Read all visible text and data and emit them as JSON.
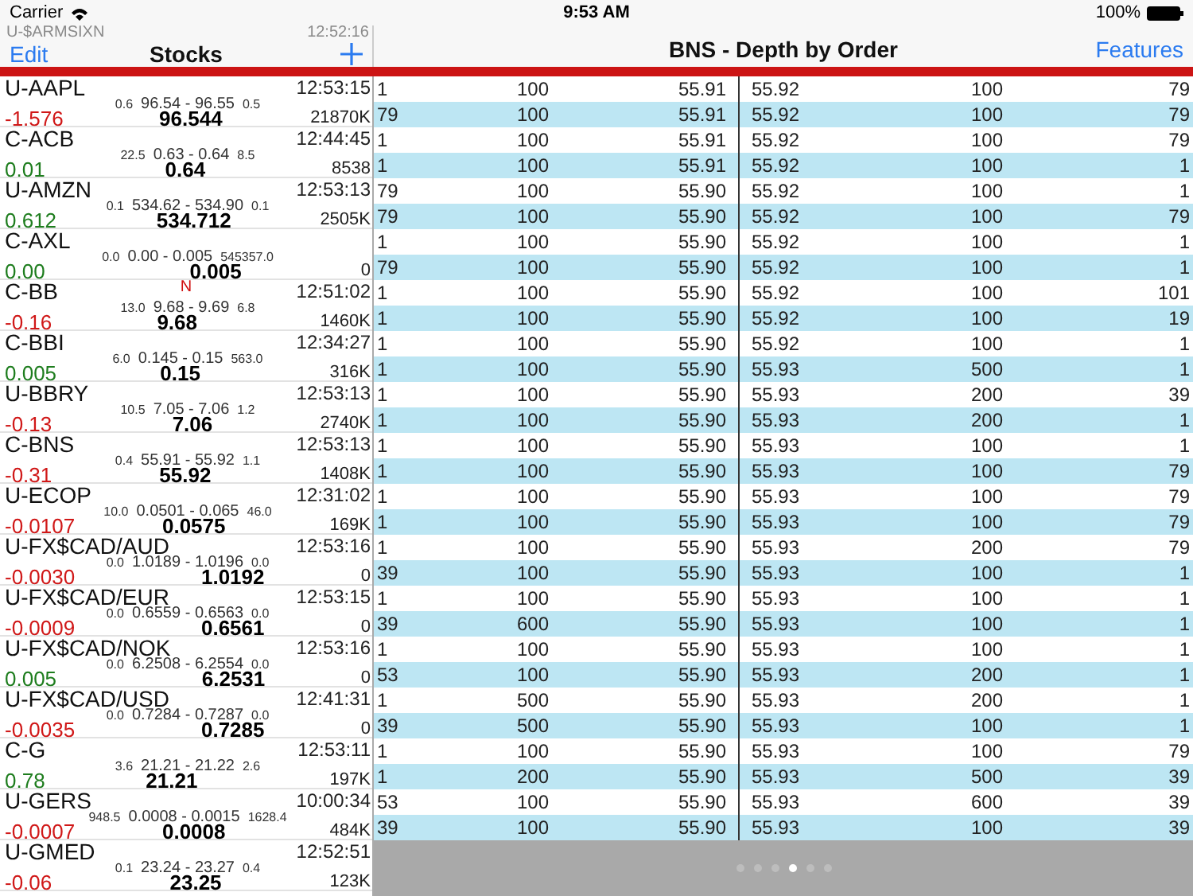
{
  "status_bar": {
    "carrier": "Carrier",
    "time": "9:53 AM",
    "battery": "100%"
  },
  "stocks_panel": {
    "edit_button": "Edit",
    "title": "Stocks",
    "ghost_row": {
      "symbol": "U-$ARMSIXN",
      "time": "12:52:16"
    },
    "stocks": [
      {
        "symbol": "U-AAPL",
        "time": "12:53:15",
        "bid_size": "0.6",
        "range": "96.54 - 96.55",
        "ask_size": "0.5",
        "change": "-1.576",
        "color": "#d01818",
        "last": "96.544",
        "volume": "21870K"
      },
      {
        "symbol": "C-ACB",
        "time": "12:44:45",
        "bid_size": "22.5",
        "range": "0.63 - 0.64",
        "ask_size": "8.5",
        "change": "0.01",
        "color": "#1e7d1e",
        "last": "0.64",
        "volume": "8538"
      },
      {
        "symbol": "U-AMZN",
        "time": "12:53:13",
        "bid_size": "0.1",
        "range": "534.62 - 534.90",
        "ask_size": "0.1",
        "change": "0.612",
        "color": "#1e7d1e",
        "last": "534.712",
        "volume": "2505K"
      },
      {
        "symbol": "C-AXL",
        "bid_size": "0.0",
        "range": "0.00 - 0.005",
        "ask_size": "545357.0",
        "change": "0.00",
        "color": "#1e7d1e",
        "last": "0.005",
        "volume": "0"
      },
      {
        "symbol": "C-BB",
        "time": "12:51:02",
        "flag": "N",
        "bid_size": "13.0",
        "range": "9.68 - 9.69",
        "ask_size": "6.8",
        "change": "-0.16",
        "color": "#d01818",
        "last": "9.68",
        "volume": "1460K"
      },
      {
        "symbol": "C-BBI",
        "time": "12:34:27",
        "bid_size": "6.0",
        "range": "0.145 - 0.15",
        "ask_size": "563.0",
        "change": "0.005",
        "color": "#1e7d1e",
        "last": "0.15",
        "volume": "316K"
      },
      {
        "symbol": "U-BBRY",
        "time": "12:53:13",
        "bid_size": "10.5",
        "range": "7.05 - 7.06",
        "ask_size": "1.2",
        "change": "-0.13",
        "color": "#d01818",
        "last": "7.06",
        "volume": "2740K"
      },
      {
        "symbol": "C-BNS",
        "time": "12:53:13",
        "bid_size": "0.4",
        "range": "55.91 - 55.92",
        "ask_size": "1.1",
        "change": "-0.31",
        "color": "#d01818",
        "last": "55.92",
        "volume": "1408K"
      },
      {
        "symbol": "U-ECOP",
        "time": "12:31:02",
        "bid_size": "10.0",
        "range": "0.0501 - 0.065",
        "ask_size": "46.0",
        "change": "-0.0107",
        "color": "#d01818",
        "last": "0.0575",
        "volume": "169K"
      },
      {
        "symbol": "U-FX$CAD/AUD",
        "time": "12:53:16",
        "bid_size": "0.0",
        "range": "1.0189 - 1.0196",
        "ask_size": "0.0",
        "change": "-0.0030",
        "color": "#d01818",
        "last": "1.0192",
        "volume": "0"
      },
      {
        "symbol": "U-FX$CAD/EUR",
        "time": "12:53:15",
        "bid_size": "0.0",
        "range": "0.6559 - 0.6563",
        "ask_size": "0.0",
        "change": "-0.0009",
        "color": "#d01818",
        "last": "0.6561",
        "volume": "0"
      },
      {
        "symbol": "U-FX$CAD/NOK",
        "time": "12:53:16",
        "bid_size": "0.0",
        "range": "6.2508 - 6.2554",
        "ask_size": "0.0",
        "change": "0.005",
        "color": "#1e7d1e",
        "last": "6.2531",
        "volume": "0"
      },
      {
        "symbol": "U-FX$CAD/USD",
        "time": "12:41:31",
        "bid_size": "0.0",
        "range": "0.7284 - 0.7287",
        "ask_size": "0.0",
        "change": "-0.0035",
        "color": "#d01818",
        "last": "0.7285",
        "volume": "0"
      },
      {
        "symbol": "C-G",
        "time": "12:53:11",
        "bid_size": "3.6",
        "range": "21.21 - 21.22",
        "ask_size": "2.6",
        "change": "0.78",
        "color": "#1e7d1e",
        "last": "21.21",
        "volume": "197K"
      },
      {
        "symbol": "U-GERS",
        "time": "10:00:34",
        "bid_size": "948.5",
        "range": "0.0008 - 0.0015",
        "ask_size": "1628.4",
        "change": "-0.0007",
        "color": "#d01818",
        "last": "0.0008",
        "volume": "484K"
      },
      {
        "symbol": "U-GMED",
        "time": "12:52:51",
        "bid_size": "0.1",
        "range": "23.24 - 23.27",
        "ask_size": "0.4",
        "change": "-0.06",
        "color": "#d01818",
        "last": "23.25",
        "volume": "123K"
      }
    ]
  },
  "depth_panel": {
    "title": "BNS  -  Depth by Order",
    "features_button": "Features",
    "rows": [
      [
        "1",
        "100",
        "55.91",
        "55.92",
        "100",
        "79"
      ],
      [
        "79",
        "100",
        "55.91",
        "55.92",
        "100",
        "79"
      ],
      [
        "1",
        "100",
        "55.91",
        "55.92",
        "100",
        "79"
      ],
      [
        "1",
        "100",
        "55.91",
        "55.92",
        "100",
        "1"
      ],
      [
        "79",
        "100",
        "55.90",
        "55.92",
        "100",
        "1"
      ],
      [
        "79",
        "100",
        "55.90",
        "55.92",
        "100",
        "79"
      ],
      [
        "1",
        "100",
        "55.90",
        "55.92",
        "100",
        "1"
      ],
      [
        "79",
        "100",
        "55.90",
        "55.92",
        "100",
        "1"
      ],
      [
        "1",
        "100",
        "55.90",
        "55.92",
        "100",
        "101"
      ],
      [
        "1",
        "100",
        "55.90",
        "55.92",
        "100",
        "19"
      ],
      [
        "1",
        "100",
        "55.90",
        "55.92",
        "100",
        "1"
      ],
      [
        "1",
        "100",
        "55.90",
        "55.93",
        "500",
        "1"
      ],
      [
        "1",
        "100",
        "55.90",
        "55.93",
        "200",
        "39"
      ],
      [
        "1",
        "100",
        "55.90",
        "55.93",
        "200",
        "1"
      ],
      [
        "1",
        "100",
        "55.90",
        "55.93",
        "100",
        "1"
      ],
      [
        "1",
        "100",
        "55.90",
        "55.93",
        "100",
        "79"
      ],
      [
        "1",
        "100",
        "55.90",
        "55.93",
        "100",
        "79"
      ],
      [
        "1",
        "100",
        "55.90",
        "55.93",
        "100",
        "79"
      ],
      [
        "1",
        "100",
        "55.90",
        "55.93",
        "200",
        "79"
      ],
      [
        "39",
        "100",
        "55.90",
        "55.93",
        "100",
        "1"
      ],
      [
        "1",
        "100",
        "55.90",
        "55.93",
        "100",
        "1"
      ],
      [
        "39",
        "600",
        "55.90",
        "55.93",
        "100",
        "1"
      ],
      [
        "1",
        "100",
        "55.90",
        "55.93",
        "100",
        "1"
      ],
      [
        "53",
        "100",
        "55.90",
        "55.93",
        "200",
        "1"
      ],
      [
        "1",
        "500",
        "55.90",
        "55.93",
        "200",
        "1"
      ],
      [
        "39",
        "500",
        "55.90",
        "55.93",
        "100",
        "1"
      ],
      [
        "1",
        "100",
        "55.90",
        "55.93",
        "100",
        "79"
      ],
      [
        "1",
        "200",
        "55.90",
        "55.93",
        "500",
        "39"
      ],
      [
        "53",
        "100",
        "55.90",
        "55.93",
        "600",
        "39"
      ],
      [
        "39",
        "100",
        "55.90",
        "55.93",
        "100",
        "39"
      ]
    ],
    "page_indicator": {
      "pages": [
        {
          "selected": false
        },
        {
          "selected": false
        },
        {
          "selected": false
        },
        {
          "selected": true
        },
        {
          "selected": false
        },
        {
          "selected": false
        }
      ]
    }
  }
}
